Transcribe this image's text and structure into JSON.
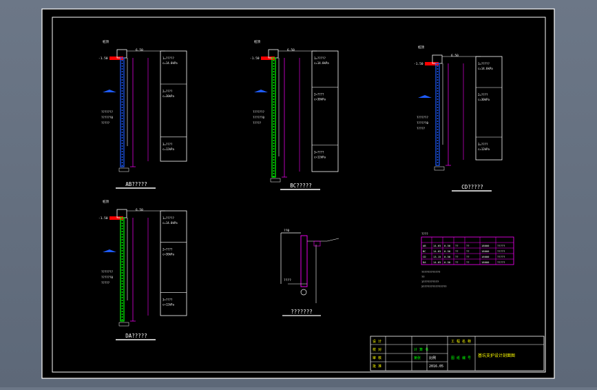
{
  "colors": {
    "background": "#000000",
    "frame": "#ffffff",
    "dimension": "#ff00ff",
    "pile": "#00ff00",
    "soil": "#1e5cff",
    "label": "#ffffff",
    "accent": "#ffff00",
    "marker": "#ff0000"
  },
  "sections": [
    {
      "caption": "AB?????",
      "top_mark": "6.50",
      "layers": [
        {
          "lines": [
            "1=?????",
            "c=14.0kPa"
          ]
        },
        {
          "lines": [
            "2=????",
            "c=30kPa"
          ]
        },
        {
          "lines": [
            "3=????",
            "c=12kPa"
          ]
        }
      ],
      "soil_notes": [
        "???????",
        "??????0",
        "?????"
      ]
    },
    {
      "caption": "BC?????",
      "top_mark": "6.50",
      "layers": [
        {
          "lines": [
            "1=?????",
            "c=14.0kPa"
          ]
        },
        {
          "lines": [
            "2=????",
            "c=30kPa"
          ]
        },
        {
          "lines": [
            "3=????",
            "c=12kPa"
          ]
        }
      ],
      "soil_notes": [
        "???????",
        "??????0",
        "?????"
      ]
    },
    {
      "caption": "CD?????",
      "top_mark": "6.50",
      "layers": [
        {
          "lines": [
            "1=?????",
            "c=14.0kPa"
          ]
        },
        {
          "lines": [
            "2=????",
            "c=30kPa"
          ]
        },
        {
          "lines": [
            "3=????",
            "c=12kPa"
          ]
        }
      ],
      "soil_notes": [
        "???????",
        "??????0",
        "?????"
      ]
    },
    {
      "caption": "DA?????",
      "top_mark": "6.50",
      "layers": [
        {
          "lines": [
            "1=?????",
            "c=14.0kPa"
          ]
        },
        {
          "lines": [
            "2=????",
            "c=30kPa"
          ]
        },
        {
          "lines": [
            "3=????",
            "c=12kPa"
          ]
        }
      ],
      "soil_notes": [
        "???????",
        "??????0",
        "?????"
      ]
    }
  ],
  "detail": {
    "caption": "???????",
    "label_top": "??0",
    "label_mid": "????"
  },
  "table": {
    "caption": "????",
    "rows": [
      [
        "AB",
        "14.65",
        "0.50",
        "??",
        "??",
        "18000",
        "?????"
      ],
      [
        "BC",
        "14.65",
        "0.50",
        "??",
        "??",
        "18000",
        "?????"
      ],
      [
        "CD",
        "13.15",
        "0.50",
        "??",
        "??",
        "16000",
        "?????"
      ],
      [
        "DA",
        "14.65",
        "0.50",
        "??",
        "??",
        "18000",
        "?????"
      ]
    ],
    "notes": [
      "????????????",
      "??",
      "1??????????",
      "2???????????????"
    ]
  },
  "title_block": {
    "project": "基坑支护设计剖面图",
    "fields_left": [
      "设 计",
      "校 对",
      "审 核",
      "批 准"
    ],
    "fields_mid": [
      "计 算 书",
      "第张",
      "比例",
      "2016.05"
    ],
    "fields_right": [
      "工 程 名 称",
      "图 纸 编 号"
    ]
  }
}
